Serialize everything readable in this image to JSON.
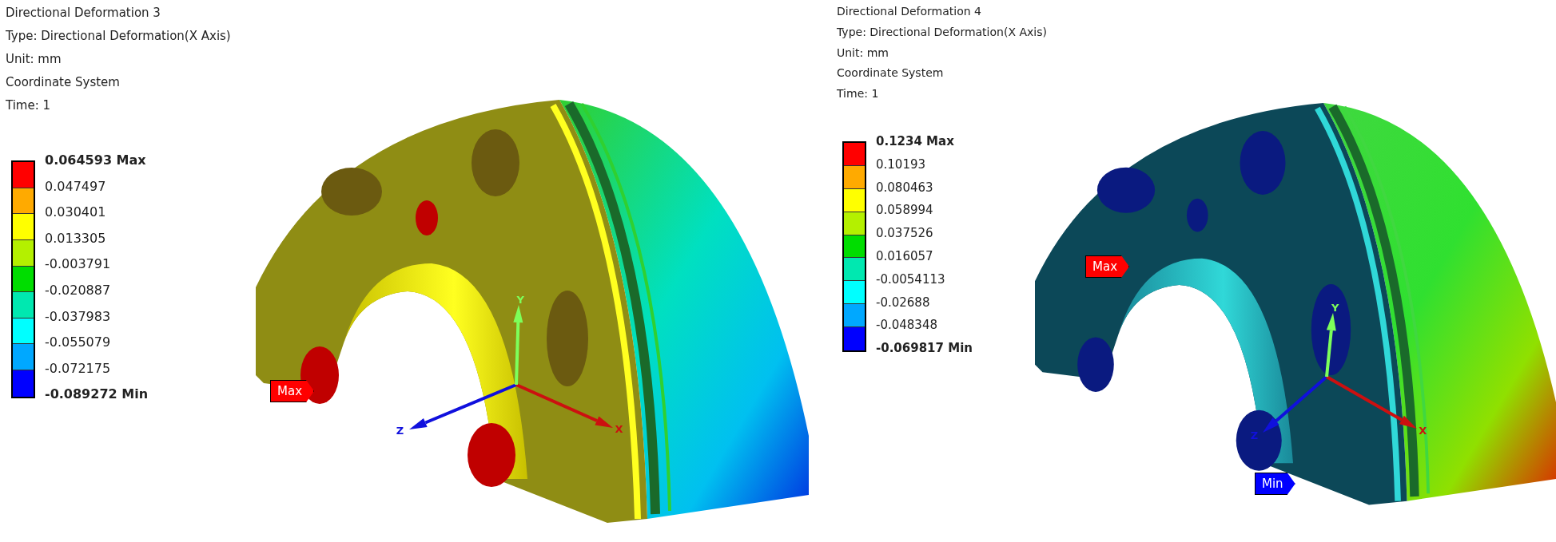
{
  "panels": [
    {
      "title": "Directional Deformation 3",
      "info": [
        "Type: Directional Deformation(X Axis)",
        "Unit: mm",
        "Coordinate System",
        "Time: 1"
      ],
      "legend": {
        "labels": [
          {
            "text": "0.064593 Max",
            "kind": "max"
          },
          {
            "text": "0.047497",
            "kind": "mid"
          },
          {
            "text": "0.030401",
            "kind": "mid"
          },
          {
            "text": "0.013305",
            "kind": "mid"
          },
          {
            "text": "-0.003791",
            "kind": "mid"
          },
          {
            "text": "-0.020887",
            "kind": "mid"
          },
          {
            "text": "-0.037983",
            "kind": "mid"
          },
          {
            "text": "-0.055079",
            "kind": "mid"
          },
          {
            "text": "-0.072175",
            "kind": "mid"
          },
          {
            "text": "-0.089272 Min",
            "kind": "min"
          }
        ],
        "bands": [
          {
            "color": "#ff0000"
          },
          {
            "color": "#ffaa00"
          },
          {
            "color": "#ffff00"
          },
          {
            "color": "#b4f000"
          },
          {
            "color": "#00dd00"
          },
          {
            "color": "#00e8b0"
          },
          {
            "color": "#00ffff"
          },
          {
            "color": "#00a8ff"
          },
          {
            "color": "#0000ff"
          }
        ]
      },
      "probes": [
        {
          "label": "Max",
          "kind": "max"
        }
      ],
      "triad": [
        {
          "label": "Z",
          "kind": "z"
        },
        {
          "label": "X",
          "kind": "x"
        },
        {
          "label": "Y",
          "kind": "y"
        }
      ]
    },
    {
      "title": "Directional Deformation 4",
      "info": [
        "Type: Directional Deformation(X Axis)",
        "Unit: mm",
        "Coordinate System",
        "Time: 1"
      ],
      "legend": {
        "labels": [
          {
            "text": "0.1234 Max",
            "kind": "max"
          },
          {
            "text": "0.10193",
            "kind": "mid"
          },
          {
            "text": "0.080463",
            "kind": "mid"
          },
          {
            "text": "0.058994",
            "kind": "mid"
          },
          {
            "text": "0.037526",
            "kind": "mid"
          },
          {
            "text": "0.016057",
            "kind": "mid"
          },
          {
            "text": "-0.0054113",
            "kind": "mid"
          },
          {
            "text": "-0.02688",
            "kind": "mid"
          },
          {
            "text": "-0.048348",
            "kind": "mid"
          },
          {
            "text": "-0.069817 Min",
            "kind": "min"
          }
        ],
        "bands": [
          {
            "color": "#ff0000"
          },
          {
            "color": "#ffaa00"
          },
          {
            "color": "#ffff00"
          },
          {
            "color": "#b4f000"
          },
          {
            "color": "#00dd00"
          },
          {
            "color": "#00e8b0"
          },
          {
            "color": "#00ffff"
          },
          {
            "color": "#00a8ff"
          },
          {
            "color": "#0000ff"
          }
        ]
      },
      "probes": [
        {
          "label": "Max",
          "kind": "max"
        },
        {
          "label": "Min",
          "kind": "min"
        }
      ],
      "triad": [
        {
          "label": "Z",
          "kind": "z"
        },
        {
          "label": "X",
          "kind": "x"
        },
        {
          "label": "Y",
          "kind": "y"
        }
      ]
    }
  ]
}
